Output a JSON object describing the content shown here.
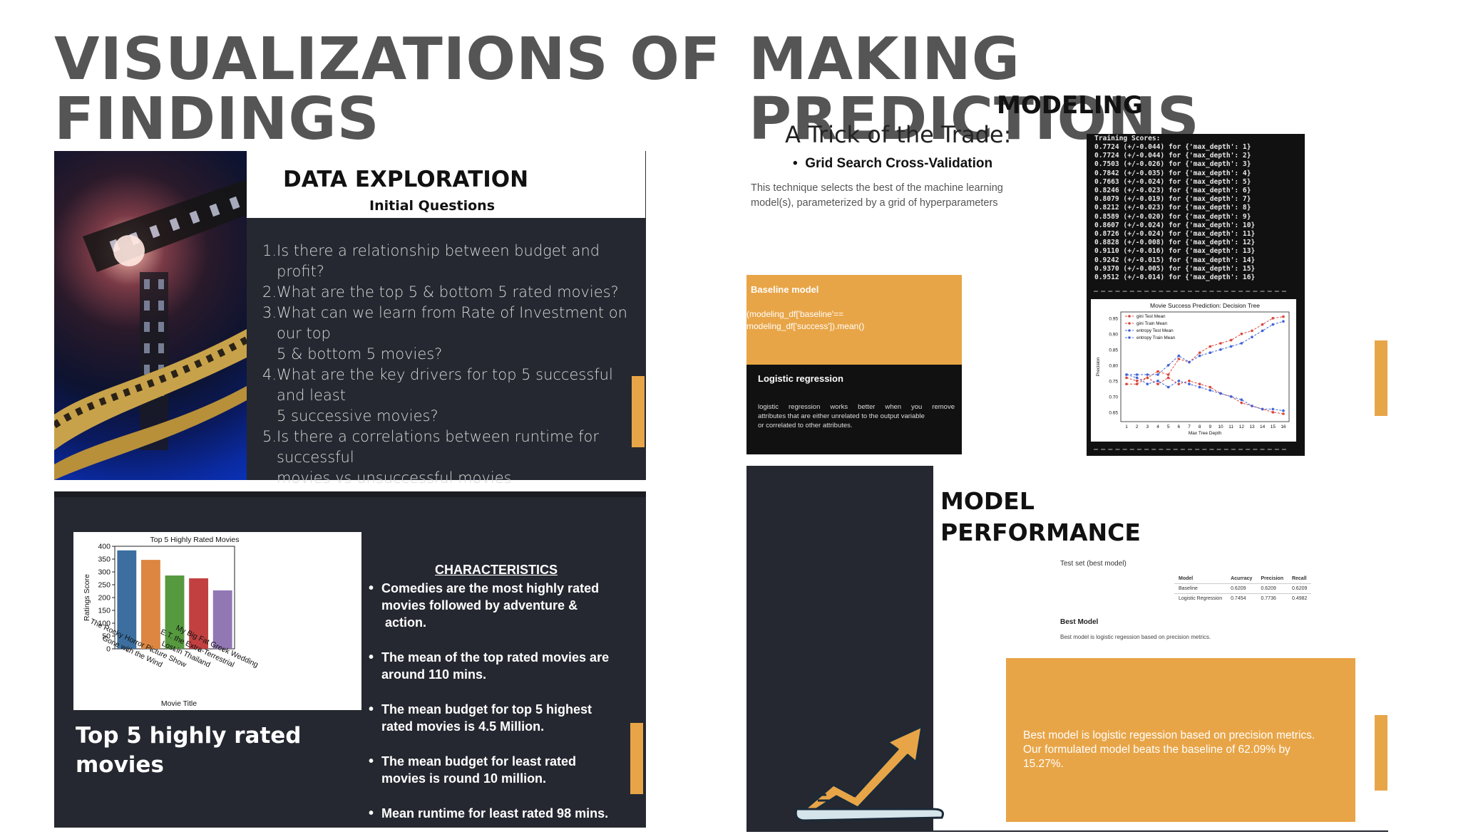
{
  "left": {
    "title_line1": "VISUALIZATIONS OF",
    "title_line2": "FINDINGS",
    "data_exploration": {
      "heading": "DATA EXPLORATION",
      "subheading": "Initial Questions",
      "questions": [
        {
          "num": "1.",
          "lines": [
            "Is there a relationship between budget and profit?"
          ]
        },
        {
          "num": "2.",
          "lines": [
            "What are the top 5 & bottom 5 rated movies?"
          ]
        },
        {
          "num": "3.",
          "lines": [
            "What can we learn from Rate of Investment on our top",
            "5 & bottom 5 movies?"
          ]
        },
        {
          "num": "4.",
          "lines": [
            "What are the key drivers for top 5 successful and least",
            "5 successive movies?"
          ]
        },
        {
          "num": "5.",
          "lines": [
            "Is there a correlations between runtime for successful",
            "movies vs unsuccessful movies"
          ]
        }
      ]
    },
    "top5_caption_line1": "Top 5 highly rated",
    "top5_caption_line2": "movies",
    "characteristics": {
      "heading": "CHARACTERISTICS",
      "items": [
        [
          "Comedies are the most highly rated",
          "movies followed by adventure &",
          " action."
        ],
        [
          "The mean of the top rated movies are",
          "around 110 mins."
        ],
        [
          "The mean budget for top 5 highest",
          "rated movies is 4.5 Million."
        ],
        [
          "The mean budget for least rated",
          "movies is round 10 million."
        ],
        [
          "Mean runtime for least rated 98 mins."
        ]
      ]
    }
  },
  "chart_data": [
    {
      "type": "bar",
      "title": "Top 5 Highly Rated Movies",
      "xlabel": "Movie Title",
      "ylabel": "Ratings Score",
      "categories": [
        "Gone with the Wind",
        "The Rocky Horror Picture Show",
        "Lost in Thailand",
        "E.T. the Extra-Terrestrial",
        "My Big Fat Greek Wedding"
      ],
      "values": [
        384,
        347,
        286,
        275,
        228
      ],
      "colors": [
        "#3c6fa0",
        "#dd8641",
        "#56993f",
        "#c24140",
        "#9277b5"
      ],
      "ylim": [
        0,
        400
      ],
      "yticks": [
        0,
        50,
        100,
        150,
        200,
        250,
        300,
        350,
        400
      ]
    },
    {
      "type": "line",
      "title": "Movie Success Prediction: Decision Tree",
      "xlabel": "Max Tree Depth",
      "ylabel": "Precision",
      "x": [
        1,
        2,
        3,
        4,
        5,
        6,
        7,
        8,
        9,
        10,
        11,
        12,
        13,
        14,
        15,
        16
      ],
      "ylim": [
        0.62,
        0.97
      ],
      "yticks": [
        0.65,
        0.7,
        0.75,
        0.8,
        0.85,
        0.9,
        0.95
      ],
      "legend": "top-left",
      "series": [
        {
          "name": "gini Test Mean",
          "color": "#d9463a",
          "values": [
            0.76,
            0.75,
            0.76,
            0.74,
            0.76,
            0.74,
            0.75,
            0.74,
            0.73,
            0.71,
            0.7,
            0.68,
            0.67,
            0.66,
            0.65,
            0.645
          ]
        },
        {
          "name": "gini Train Mean",
          "color": "#d9463a",
          "values": [
            0.74,
            0.74,
            0.76,
            0.78,
            0.77,
            0.82,
            0.81,
            0.84,
            0.86,
            0.87,
            0.88,
            0.9,
            0.91,
            0.93,
            0.95,
            0.955
          ]
        },
        {
          "name": "entropy Test Mean",
          "color": "#3f63d8",
          "values": [
            0.77,
            0.76,
            0.74,
            0.75,
            0.73,
            0.75,
            0.74,
            0.73,
            0.72,
            0.71,
            0.7,
            0.69,
            0.67,
            0.66,
            0.66,
            0.655
          ]
        },
        {
          "name": "entropy Train Mean",
          "color": "#3f63d8",
          "values": [
            0.77,
            0.77,
            0.77,
            0.77,
            0.8,
            0.83,
            0.81,
            0.83,
            0.84,
            0.85,
            0.86,
            0.87,
            0.89,
            0.91,
            0.93,
            0.94
          ]
        }
      ]
    }
  ],
  "right": {
    "title": "MAKING PREDICTIONS",
    "modeling": "MODELING",
    "trick": "A Trick of the Trade:",
    "bullet": "Grid Search Cross-Validation",
    "desc_line1": "This technique selects the best of the machine learning",
    "desc_line2": "model(s), parameterized by a grid of hyperparameters",
    "training_scores_title": "Training Scores:",
    "training_scores": [
      "0.7724 (+/-0.044) for {'max_depth': 1}",
      "0.7724 (+/-0.044) for {'max_depth': 2}",
      "0.7503 (+/-0.026) for {'max_depth': 3}",
      "0.7842 (+/-0.035) for {'max_depth': 4}",
      "0.7663 (+/-0.024) for {'max_depth': 5}",
      "0.8246 (+/-0.023) for {'max_depth': 6}",
      "0.8079 (+/-0.019) for {'max_depth': 7}",
      "0.8212 (+/-0.023) for {'max_depth': 8}",
      "0.8589 (+/-0.020) for {'max_depth': 9}",
      "0.8607 (+/-0.024) for {'max_depth': 10}",
      "0.8726 (+/-0.024) for {'max_depth': 11}",
      "0.8828 (+/-0.008) for {'max_depth': 12}",
      "0.9110 (+/-0.016) for {'max_depth': 13}",
      "0.9242 (+/-0.015) for {'max_depth': 14}",
      "0.9370 (+/-0.005) for {'max_depth': 15}",
      "0.9512 (+/-0.014) for {'max_depth': 16}"
    ],
    "baseline_title": "Baseline model",
    "baseline_code_line1": "(modeling_df['baseline'==",
    "baseline_code_line2": "modeling_df['success']).mean()",
    "logistic_title": "Logistic regression",
    "logistic_desc_line1": "logistic regression works better when you remove",
    "logistic_desc_line2": "attributes that are either unrelated to the output variable",
    "logistic_desc_line3": "or correlated to other attributes.",
    "model_perf_line1": "MODEL",
    "model_perf_line2": "PERFORMANCE",
    "test_set_title": "Test set (best model)",
    "table": {
      "headers": [
        "Model",
        "Acurracy",
        "Precision",
        "Recall"
      ],
      "rows": [
        [
          "Baseline",
          "0.6209",
          "0.6209",
          "0.6209"
        ],
        [
          "Logistic Regression",
          "0.7454",
          "0.7736",
          "0.4982"
        ]
      ]
    },
    "best_model_title": "Best Model",
    "best_model_small": "Best model is logistic regession based on precision metrics.",
    "best_model_box_line1": "Best model is logistic regession based on precision metrics.",
    "best_model_box_line2": "Our formulated model beats the baseline of 62.09% by",
    "best_model_box_line3": "15.27%."
  }
}
